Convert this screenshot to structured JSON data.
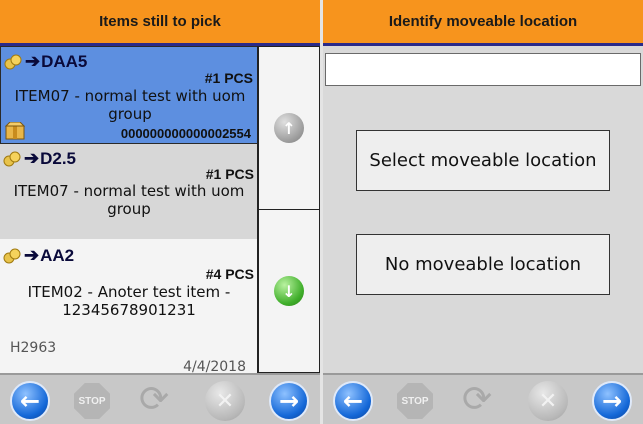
{
  "left": {
    "header": "Items still to pick",
    "items": [
      {
        "location": "DAA5",
        "quantity": "#1 PCS",
        "description": "ITEM07 - normal test with uom group",
        "barcode": "000000000000002554",
        "state": "selected"
      },
      {
        "location": "D2.5",
        "quantity": "#1 PCS",
        "description": "ITEM07 - normal test with uom group",
        "state": "grey"
      },
      {
        "location": "AA2",
        "quantity": "#4 PCS",
        "description": "ITEM02 - Anoter test item - 12345678901231",
        "code": "H2963",
        "date": "4/4/2018",
        "state": "white"
      }
    ],
    "scroll": {
      "up_icon": "arrow-up-icon",
      "down_icon": "arrow-down-icon"
    }
  },
  "right": {
    "header": "Identify moveable location",
    "input_value": "",
    "select_button": "Select moveable location",
    "none_button": "No moveable location"
  },
  "footer": {
    "back_icon": "arrow-left-icon",
    "stop_label": "STOP",
    "refresh_icon": "refresh-icon",
    "cancel_icon": "close-icon",
    "next_icon": "arrow-right-icon"
  },
  "colors": {
    "header": "#f7941d",
    "selected_row": "#5d8fe0",
    "accent_blue": "#1468d8",
    "green": "#3fae2a"
  }
}
